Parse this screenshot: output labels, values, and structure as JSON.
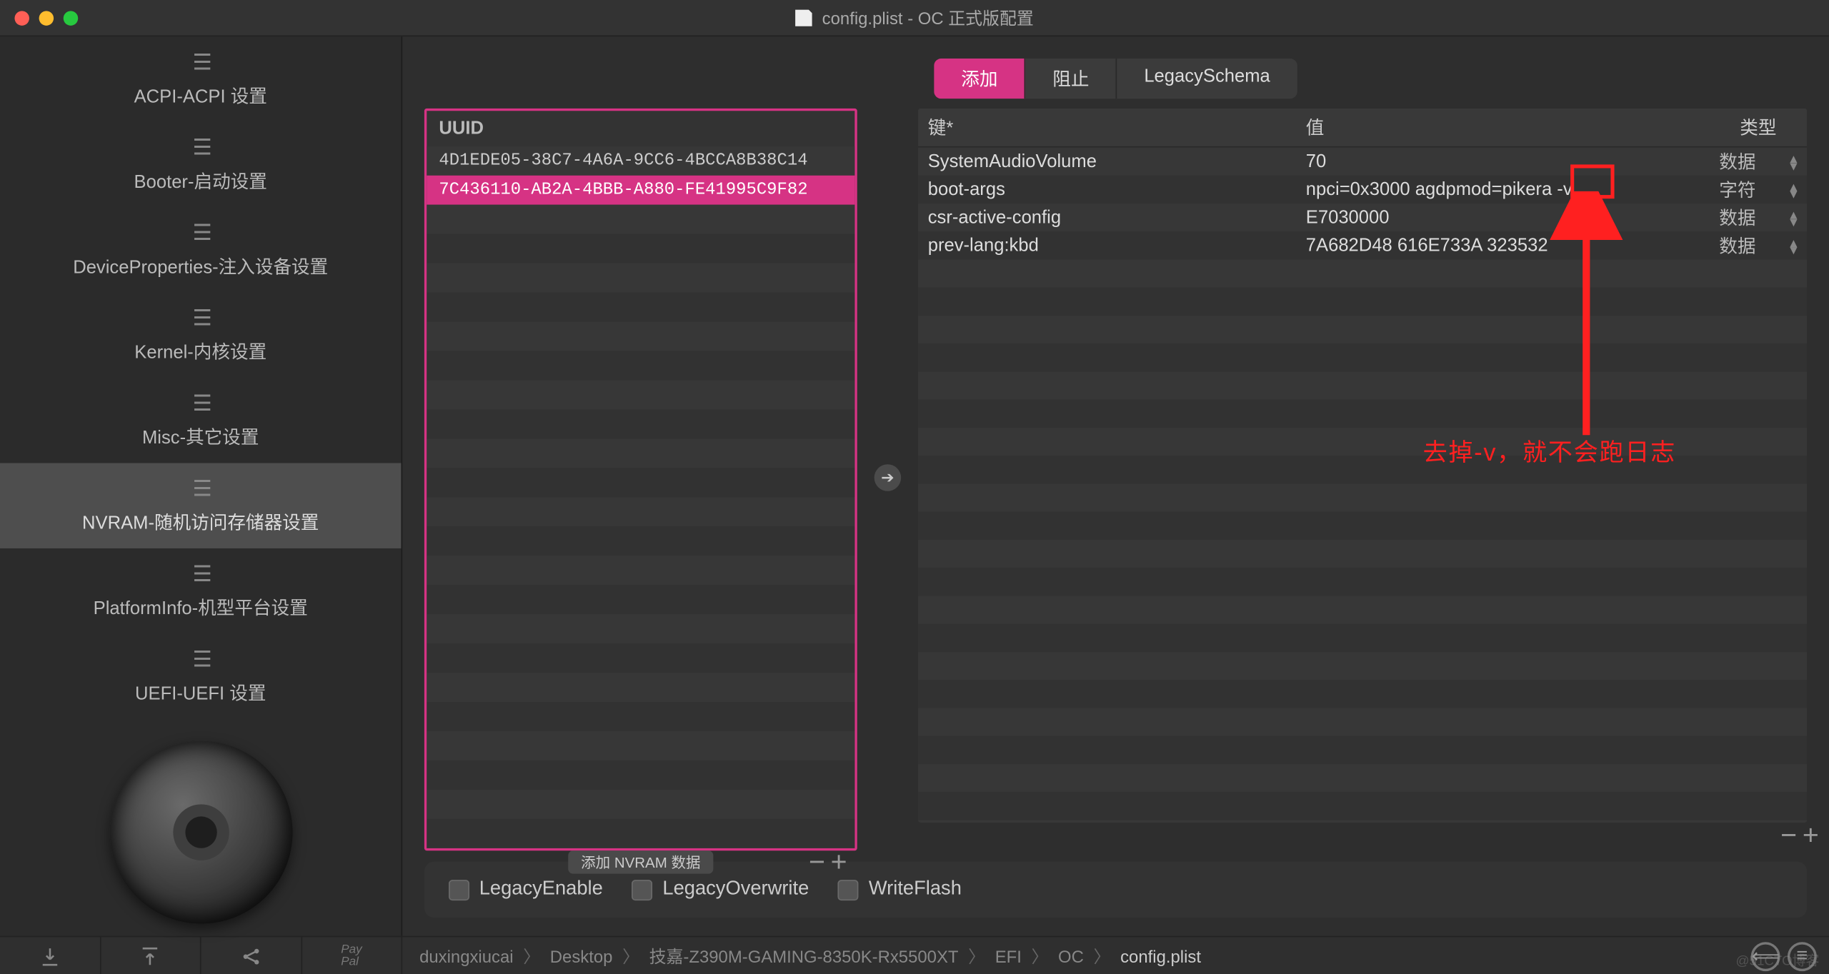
{
  "title": "config.plist - OC 正式版配置",
  "sidebar": {
    "items": [
      {
        "label": "ACPI-ACPI 设置"
      },
      {
        "label": "Booter-启动设置"
      },
      {
        "label": "DeviceProperties-注入设备设置"
      },
      {
        "label": "Kernel-内核设置"
      },
      {
        "label": "Misc-其它设置"
      },
      {
        "label": "NVRAM-随机访问存储器设置"
      },
      {
        "label": "PlatformInfo-机型平台设置"
      },
      {
        "label": "UEFI-UEFI 设置"
      }
    ],
    "active_index": 5
  },
  "tabs": {
    "items": [
      "添加",
      "阻止",
      "LegacySchema"
    ],
    "active_index": 0
  },
  "uuid_panel": {
    "header": "UUID",
    "rows": [
      "4D1EDE05-38C7-4A6A-9CC6-4BCCA8B38C14",
      "7C436110-AB2A-4BBB-A880-FE41995C9F82"
    ],
    "selected_index": 1,
    "footer_label": "添加 NVRAM 数据"
  },
  "kv_table": {
    "headers": {
      "key": "键*",
      "value": "值",
      "type": "类型"
    },
    "rows": [
      {
        "key": "SystemAudioVolume",
        "value": "70",
        "type": "数据"
      },
      {
        "key": "boot-args",
        "value": "npci=0x3000 agdpmod=pikera -v",
        "type": "字符"
      },
      {
        "key": "csr-active-config",
        "value": "E7030000",
        "type": "数据"
      },
      {
        "key": "prev-lang:kbd",
        "value": "7A682D48 616E733A 323532",
        "type": "数据"
      }
    ]
  },
  "annotation": {
    "text": "去掉-v，就不会跑日志"
  },
  "checks": {
    "items": [
      {
        "label": "LegacyEnable",
        "checked": false
      },
      {
        "label": "LegacyOverwrite",
        "checked": false
      },
      {
        "label": "WriteFlash",
        "checked": false
      }
    ]
  },
  "breadcrumb": {
    "segments": [
      "duxingxiucai",
      "Desktop",
      "技嘉-Z390M-GAMING-8350K-Rx5500XT",
      "EFI",
      "OC",
      "config.plist"
    ]
  },
  "footer_icons": {
    "paypal": "Pay\nPal"
  },
  "watermark": "@51CTO博客"
}
